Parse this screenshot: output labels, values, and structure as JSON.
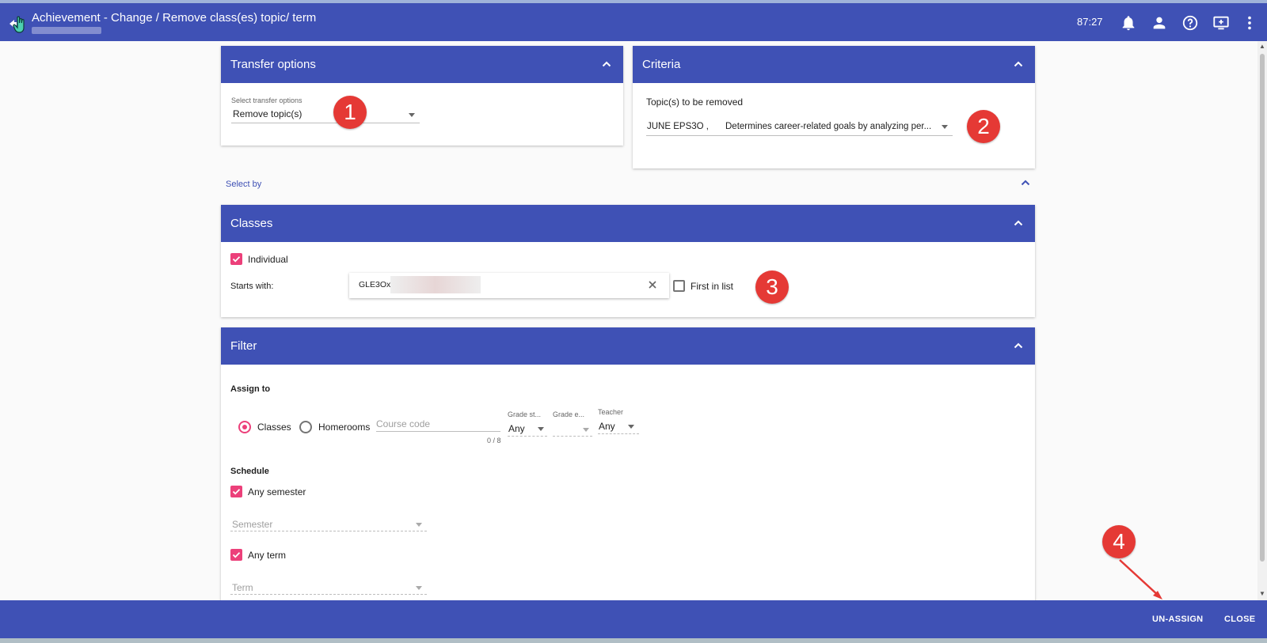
{
  "header": {
    "title": "Achievement - Change / Remove class(es) topic/ term",
    "timer": "87:27",
    "icons": [
      "back-hand-cursor-icon",
      "bell-icon",
      "person-icon",
      "help-icon",
      "monitor-icon",
      "more-vert-icon"
    ]
  },
  "transfer_options": {
    "title": "Transfer options",
    "select_label": "Select transfer options",
    "select_value": "Remove topic(s)"
  },
  "criteria": {
    "title": "Criteria",
    "topics_label": "Topic(s) to be removed",
    "topic_code": "JUNE EPS3O ,",
    "topic_desc": "Determines career-related goals by analyzing per..."
  },
  "select_by": {
    "label": "Select by"
  },
  "classes": {
    "title": "Classes",
    "individual_label": "Individual",
    "individual_checked": true,
    "starts_with_label": "Starts with:",
    "starts_with_value": "GLE3Ox",
    "first_in_list_label": "First in list",
    "first_in_list_checked": false
  },
  "filter": {
    "title": "Filter",
    "assign_to_label": "Assign to",
    "radio_classes": "Classes",
    "radio_homerooms": "Homerooms",
    "selected_radio": "Classes",
    "course_code_placeholder": "Course code",
    "course_code_counter": "0 / 8",
    "grade_start_label": "Grade st...",
    "grade_start_value": "Any",
    "grade_end_label": "Grade e...",
    "grade_end_value": "",
    "teacher_label": "Teacher",
    "teacher_value": "Any",
    "schedule_label": "Schedule",
    "any_semester_label": "Any semester",
    "any_semester_checked": true,
    "semester_placeholder": "Semester",
    "any_term_label": "Any term",
    "any_term_checked": true,
    "term_placeholder": "Term"
  },
  "footer": {
    "unassign_label": "UN-ASSIGN",
    "close_label": "CLOSE"
  },
  "annotations": {
    "badge_1": "1",
    "badge_2": "2",
    "badge_3": "3",
    "badge_4": "4",
    "badge_color": "#e53935"
  },
  "colors": {
    "primary": "#3f51b5",
    "accent": "#ec407a"
  }
}
